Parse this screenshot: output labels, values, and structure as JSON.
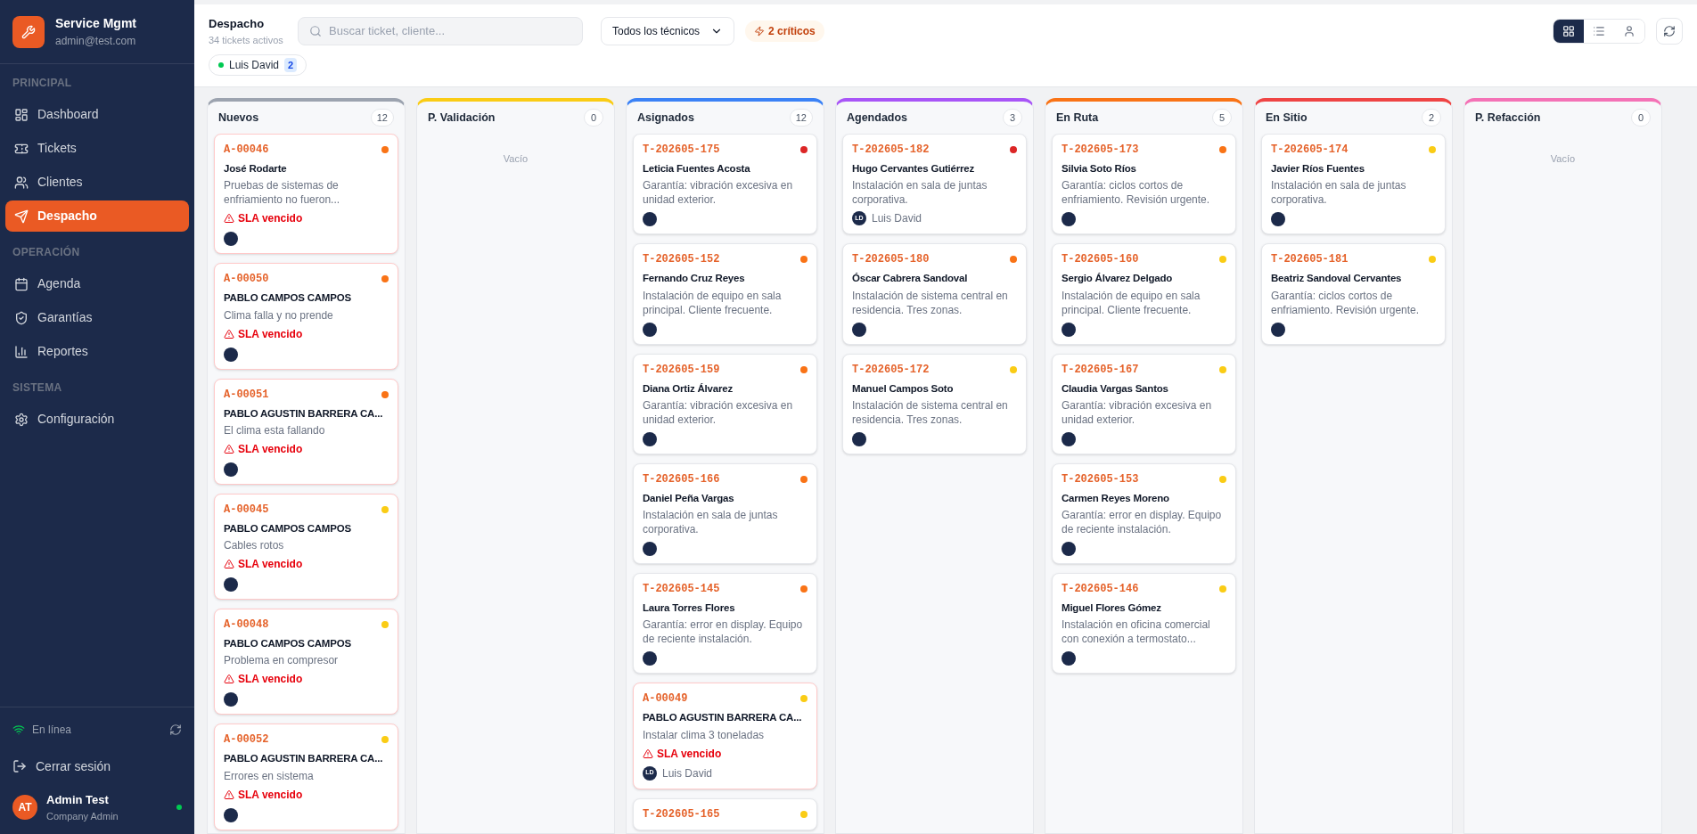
{
  "brand": {
    "name": "Service Mgmt",
    "email": "admin@test.com"
  },
  "sidebar": {
    "sections": [
      {
        "title": "PRINCIPAL",
        "items": [
          {
            "label": "Dashboard",
            "selected": false
          },
          {
            "label": "Tickets",
            "selected": false
          },
          {
            "label": "Clientes",
            "selected": false
          },
          {
            "label": "Despacho",
            "selected": true
          }
        ]
      },
      {
        "title": "OPERACIÓN",
        "items": [
          {
            "label": "Agenda",
            "selected": false
          },
          {
            "label": "Garantías",
            "selected": false
          },
          {
            "label": "Reportes",
            "selected": false
          }
        ]
      },
      {
        "title": "SISTEMA",
        "items": [
          {
            "label": "Configuración",
            "selected": false
          }
        ]
      }
    ],
    "status": {
      "label": "En línea",
      "online": true
    },
    "logout": "Cerrar sesión",
    "user": {
      "initials": "AT",
      "name": "Admin Test",
      "role": "Company Admin",
      "online": true
    }
  },
  "header": {
    "title": "Despacho",
    "subtitle": "34 tickets activos",
    "search": {
      "placeholder": "Buscar ticket, cliente..."
    },
    "technician_select": "Todos los técnicos",
    "critical_badge": "2 críticos",
    "technicians": [
      {
        "name": "Luis David",
        "count": "2",
        "online": true
      }
    ],
    "views": [
      {
        "kind": "grid",
        "selected": true
      },
      {
        "kind": "list",
        "selected": false
      },
      {
        "kind": "person",
        "selected": false
      }
    ]
  },
  "columns": [
    {
      "title": "Nuevos",
      "count": "12",
      "color": "#9ca3af",
      "cards": [
        {
          "code": "A-00046",
          "color": "#f97316",
          "name": "José Rodarte",
          "description": "Pruebas de sistemas de enfriamiento no fueron...",
          "alert": "SLA vencido"
        },
        {
          "code": "A-00050",
          "color": "#f97316",
          "name": "PABLO CAMPOS CAMPOS",
          "description": "Clima falla y no prende",
          "alert": "SLA vencido"
        },
        {
          "code": "A-00051",
          "color": "#f97316",
          "name": "PABLO AGUSTIN BARRERA CA...",
          "description": "El clima esta fallando",
          "alert": "SLA vencido"
        },
        {
          "code": "A-00045",
          "color": "#facc15",
          "name": "PABLO CAMPOS CAMPOS",
          "description": "Cables rotos",
          "alert": "SLA vencido"
        },
        {
          "code": "A-00048",
          "color": "#facc15",
          "name": "PABLO CAMPOS CAMPOS",
          "description": "Problema en compresor",
          "alert": "SLA vencido"
        },
        {
          "code": "A-00052",
          "color": "#facc15",
          "name": "PABLO AGUSTIN BARRERA CA...",
          "description": "Errores en sistema",
          "alert": "SLA vencido"
        }
      ]
    },
    {
      "title": "P. Validación",
      "count": "0",
      "color": "#facc15",
      "empty": "Vacío"
    },
    {
      "title": "Asignados",
      "count": "12",
      "color": "#3b82f6",
      "cards": [
        {
          "code": "T-202605-175",
          "color": "#dc2626",
          "name": "Leticia Fuentes Acosta",
          "description": "Garantía: vibración excesiva en unidad exterior."
        },
        {
          "code": "T-202605-152",
          "color": "#f97316",
          "name": "Fernando Cruz Reyes",
          "description": "Instalación de equipo en sala principal. Cliente frecuente."
        },
        {
          "code": "T-202605-159",
          "color": "#f97316",
          "name": "Diana Ortiz Álvarez",
          "description": "Garantía: vibración excesiva en unidad exterior."
        },
        {
          "code": "T-202605-166",
          "color": "#f97316",
          "name": "Daniel Peña Vargas",
          "description": "Instalación en sala de juntas corporativa."
        },
        {
          "code": "T-202605-145",
          "color": "#f97316",
          "name": "Laura Torres Flores",
          "description": "Garantía: error en display. Equipo de reciente instalación."
        },
        {
          "code": "A-00049",
          "color": "#facc15",
          "name": "PABLO AGUSTIN BARRERA CA...",
          "description": "Instalar clima 3 toneladas",
          "alert": "SLA vencido",
          "assignee": {
            "initials": "LD",
            "name": "Luis David"
          }
        },
        {
          "code": "T-202605-165",
          "color": "#facc15"
        }
      ]
    },
    {
      "title": "Agendados",
      "count": "3",
      "color": "#a855f7",
      "cards": [
        {
          "code": "T-202605-182",
          "color": "#dc2626",
          "name": "Hugo Cervantes Gutiérrez",
          "description": "Instalación en sala de juntas corporativa.",
          "assignee": {
            "initials": "LD",
            "name": "Luis David"
          }
        },
        {
          "code": "T-202605-180",
          "color": "#f97316",
          "name": "Óscar Cabrera Sandoval",
          "description": "Instalación de sistema central en residencia. Tres zonas."
        },
        {
          "code": "T-202605-172",
          "color": "#facc15",
          "name": "Manuel Campos Soto",
          "description": "Instalación de sistema central en residencia. Tres zonas."
        }
      ]
    },
    {
      "title": "En Ruta",
      "count": "5",
      "color": "#f97316",
      "cards": [
        {
          "code": "T-202605-173",
          "color": "#f97316",
          "name": "Silvia Soto Ríos",
          "description": "Garantía: ciclos cortos de enfriamiento. Revisión urgente."
        },
        {
          "code": "T-202605-160",
          "color": "#facc15",
          "name": "Sergio Álvarez Delgado",
          "description": "Instalación de equipo en sala principal. Cliente frecuente."
        },
        {
          "code": "T-202605-167",
          "color": "#facc15",
          "name": "Claudia Vargas Santos",
          "description": "Garantía: vibración excesiva en unidad exterior."
        },
        {
          "code": "T-202605-153",
          "color": "#facc15",
          "name": "Carmen Reyes Moreno",
          "description": "Garantía: error en display. Equipo de reciente instalación."
        },
        {
          "code": "T-202605-146",
          "color": "#facc15",
          "name": "Miguel Flores Gómez",
          "description": "Instalación en oficina comercial con conexión a termostato..."
        }
      ]
    },
    {
      "title": "En Sitio",
      "count": "2",
      "color": "#ef4444",
      "cards": [
        {
          "code": "T-202605-174",
          "color": "#facc15",
          "name": "Javier Ríos Fuentes",
          "description": "Instalación en sala de juntas corporativa."
        },
        {
          "code": "T-202605-181",
          "color": "#facc15",
          "name": "Beatriz Sandoval Cervantes",
          "description": "Garantía: ciclos cortos de enfriamiento. Revisión urgente."
        }
      ]
    },
    {
      "title": "P. Refacción",
      "count": "0",
      "color": "#f472b6",
      "empty": "Vacío"
    }
  ]
}
